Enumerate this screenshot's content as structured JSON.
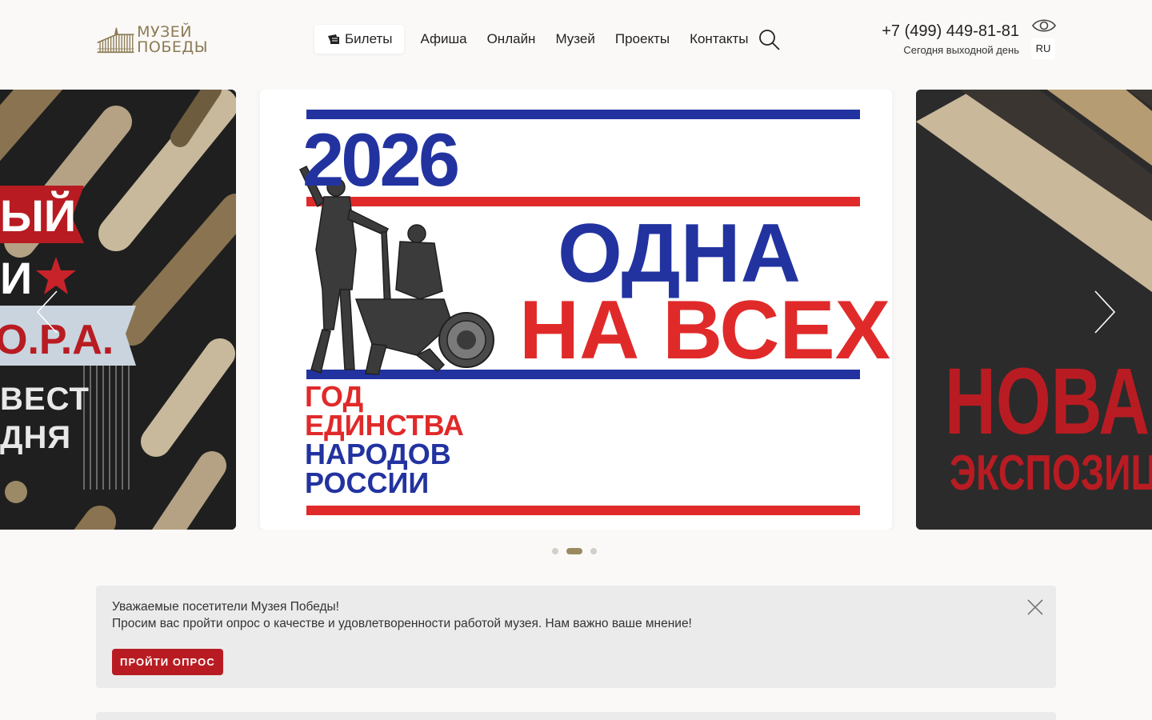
{
  "header": {
    "logo_line1": "МУЗЕЙ",
    "logo_line2": "ПОБЕДЫ",
    "nav": {
      "tickets": "Билеты",
      "items": [
        "Афиша",
        "Онлайн",
        "Музей",
        "Проекты",
        "Контакты"
      ]
    },
    "phone": "+7 (499) 449-81-81",
    "schedule": "Сегодня выходной день",
    "lang": "RU"
  },
  "slider": {
    "main": {
      "year": "2026",
      "headline_1": "ОДНА",
      "headline_2": "НА ВСЕХ",
      "subtitle": [
        "ГОД",
        "ЕДИНСТВА",
        "НАРОДОВ",
        "РОССИИ"
      ]
    },
    "left": {
      "lines": [
        "ЫЙ",
        "И",
        "О.Р.А.",
        "ВЕСТ",
        "ДНЯ"
      ]
    },
    "right": {
      "lines": [
        "НОВА",
        "ЭКСПОЗИЦ"
      ]
    },
    "dots": 3,
    "active_dot": 2
  },
  "notice": {
    "line1": "Уважаемые посетители Музея Победы!",
    "line2": "Просим вас пройти опрос о качестве и удовлетворенности работой музея. Нам важно ваше мнение!",
    "button": "ПРОЙТИ ОПРОС"
  },
  "colors": {
    "brand_gold": "#8c7a55",
    "accent_red": "#b81c22",
    "flag_blue": "#2233a0",
    "flag_red": "#e02a2a",
    "page_bg": "#faf9f7"
  }
}
